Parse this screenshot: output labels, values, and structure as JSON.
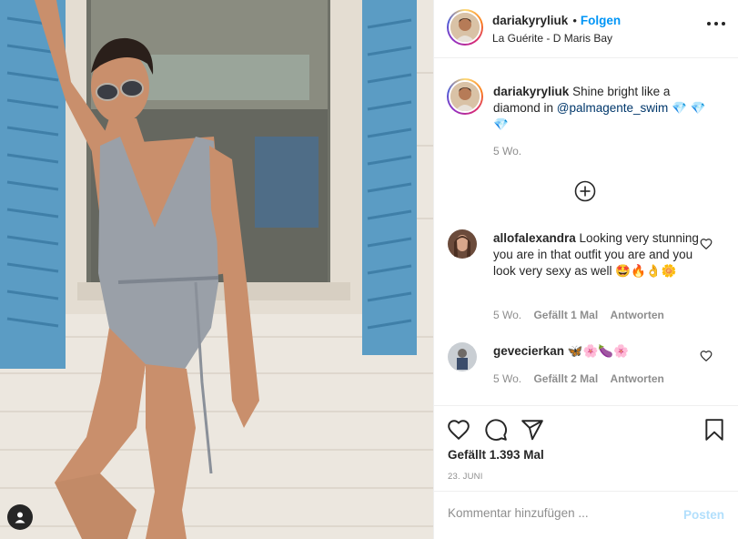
{
  "post": {
    "author": "dariakyryliuk",
    "follow_label": "Folgen",
    "location": "La Guérite - D Maris Bay",
    "dot": "•",
    "caption": {
      "username": "dariakyryliuk",
      "text_before_mention": " Shine bright like a diamond in ",
      "mention": "@palmagente_swim",
      "emojis": " 💎 💎💎",
      "age": "5 Wo."
    },
    "comments": [
      {
        "username": "allofalexandra",
        "text": " Looking very stunning you are in that outfit you are and you look very sexy as well 🤩🔥👌🌼",
        "age": "5 Wo.",
        "likes_label": "Gefällt 1 Mal",
        "reply_label": "Antworten"
      },
      {
        "username": "gevecierkan",
        "text": " 🦋🌸🍆🌸",
        "age": "5 Wo.",
        "likes_label": "Gefällt 2 Mal",
        "reply_label": "Antworten"
      }
    ],
    "likes": "Gefällt 1.393 Mal",
    "date": "23. JUNI"
  },
  "composer": {
    "placeholder": "Kommentar hinzufügen ...",
    "post_label": "Posten"
  },
  "icons": {
    "more": "more-options-icon",
    "load_more": "plus-circle-icon",
    "like": "heart-icon",
    "comment": "comment-icon",
    "share": "share-icon",
    "save": "bookmark-icon",
    "tag": "user-tag-icon"
  },
  "colors": {
    "accent": "#0095f6",
    "mention": "#00376b",
    "muted": "#8e8e8e",
    "post_disabled": "#b2dffc",
    "shutter": "#5b9cc4"
  }
}
